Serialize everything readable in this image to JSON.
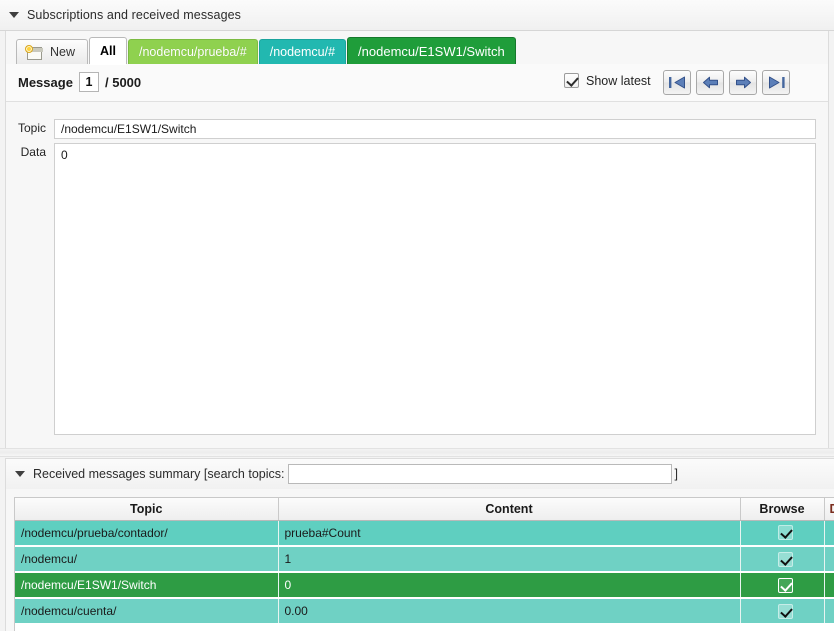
{
  "window": {
    "section_title": "Subscriptions and received messages",
    "collapse_icon": "triangle-down-icon"
  },
  "tabs": [
    {
      "label": "New",
      "kind": "new",
      "icon": "new-tab-icon",
      "color": "#ececec"
    },
    {
      "label": "All",
      "kind": "selected",
      "color": "#ffffff"
    },
    {
      "label": "/nodemcu/prueba/#",
      "kind": "lightgreen",
      "color": "#8fd14f"
    },
    {
      "label": "/nodemcu/#",
      "kind": "teal",
      "color": "#22b8b0"
    },
    {
      "label": "/nodemcu/E1SW1/Switch",
      "kind": "darkgreen",
      "color": "#1f9d3a"
    }
  ],
  "message_bar": {
    "label": "Message",
    "index": "1",
    "total_label": "/ 5000",
    "show_latest_label": "Show latest",
    "show_latest_checked": true,
    "nav": [
      {
        "name": "first-message-button",
        "icon": "skip-first-icon"
      },
      {
        "name": "previous-message-button",
        "icon": "arrow-left-icon"
      },
      {
        "name": "next-message-button",
        "icon": "arrow-right-icon"
      },
      {
        "name": "last-message-button",
        "icon": "skip-last-icon"
      }
    ]
  },
  "message_detail": {
    "topic_label": "Topic",
    "topic_value": "/nodemcu/E1SW1/Switch",
    "topic_placeholder": "",
    "data_label": "Data",
    "data_value": "0",
    "data_placeholder": ""
  },
  "summary": {
    "title_prefix": "Received messages summary [search topics:",
    "title_suffix": "]",
    "search_value": "",
    "search_placeholder": "",
    "collapse_icon": "triangle-down-icon",
    "columns": [
      "Topic",
      "Content",
      "Browse",
      "D"
    ],
    "rows": [
      {
        "topic": "/nodemcu/prueba/contador/",
        "content": "prueba#Count",
        "browse": true,
        "style": "teal"
      },
      {
        "topic": "/nodemcu/",
        "content": "1",
        "browse": true,
        "style": "teal2"
      },
      {
        "topic": "/nodemcu/E1SW1/Switch",
        "content": "0",
        "browse": true,
        "style": "green"
      },
      {
        "topic": "/nodemcu/cuenta/",
        "content": "0.00",
        "browse": true,
        "style": "teal2"
      }
    ]
  },
  "colors": {
    "tab_lightgreen": "#8fd14f",
    "tab_teal": "#22b8b0",
    "tab_darkgreen": "#1f9d3a",
    "row_teal": "#5fcfc0",
    "row_teal2": "#6fd1c4",
    "row_green": "#2e9c44",
    "nav_arrow": "#44669e"
  }
}
